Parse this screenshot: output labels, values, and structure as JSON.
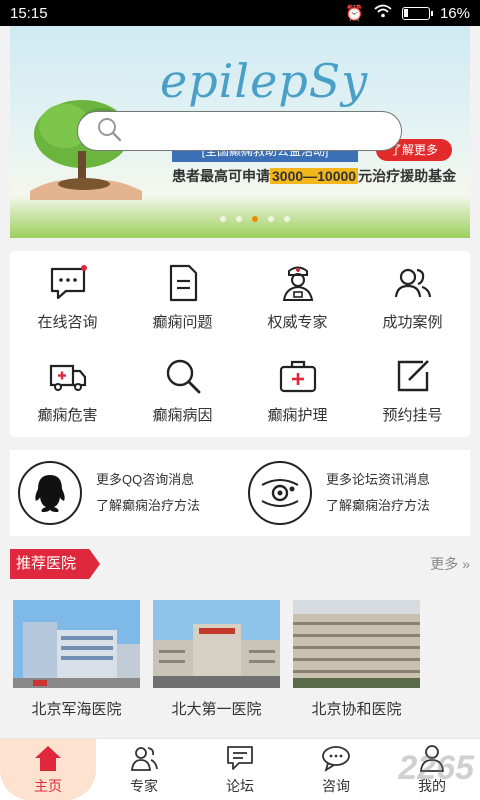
{
  "status_bar": {
    "time": "15:15",
    "battery": "16%",
    "battery_level": 0.16
  },
  "banner": {
    "brand": "epilepSy",
    "tagline": "\"↓↓↓↓↓↓ ↓↓↓↓\"",
    "blue_strip": "[全国癫痫救助公益活动]",
    "more_button": "了解更多",
    "slogan_prefix": "患者最高可申请",
    "slogan_highlight": "3000—10000",
    "slogan_suffix": "元治疗援助基金"
  },
  "search": {
    "placeholder": ""
  },
  "menu": {
    "items": [
      {
        "label": "在线咨询",
        "icon": "chat-icon"
      },
      {
        "label": "癫痫问题",
        "icon": "document-icon"
      },
      {
        "label": "权威专家",
        "icon": "doctor-icon"
      },
      {
        "label": "成功案例",
        "icon": "users-icon"
      },
      {
        "label": "癫痫危害",
        "icon": "ambulance-icon"
      },
      {
        "label": "癫痫病因",
        "icon": "search-icon"
      },
      {
        "label": "癫痫护理",
        "icon": "medical-kit-icon"
      },
      {
        "label": "预约挂号",
        "icon": "edit-icon"
      }
    ]
  },
  "info": {
    "qq": {
      "line1": "更多QQ咨询消息",
      "line2": "了解癫痫治疗方法"
    },
    "forum": {
      "line1": "更多论坛资讯消息",
      "line2": "了解癫痫治疗方法"
    }
  },
  "hospitals_section": {
    "title": "推荐医院",
    "more": "更多",
    "items": [
      {
        "name": "北京军海医院"
      },
      {
        "name": "北大第一医院"
      },
      {
        "name": "北京协和医院"
      }
    ]
  },
  "tabbar": {
    "tabs": [
      {
        "label": "主页",
        "icon": "home-icon",
        "active": true
      },
      {
        "label": "专家",
        "icon": "experts-icon"
      },
      {
        "label": "论坛",
        "icon": "forum-icon"
      },
      {
        "label": "咨询",
        "icon": "consult-icon"
      },
      {
        "label": "我的",
        "icon": "profile-icon"
      }
    ]
  },
  "watermark": "2265",
  "colors": {
    "accent": "#e0283c",
    "active_tab_bg": "#fde3cf",
    "brand_blue": "#4a9fc6"
  }
}
